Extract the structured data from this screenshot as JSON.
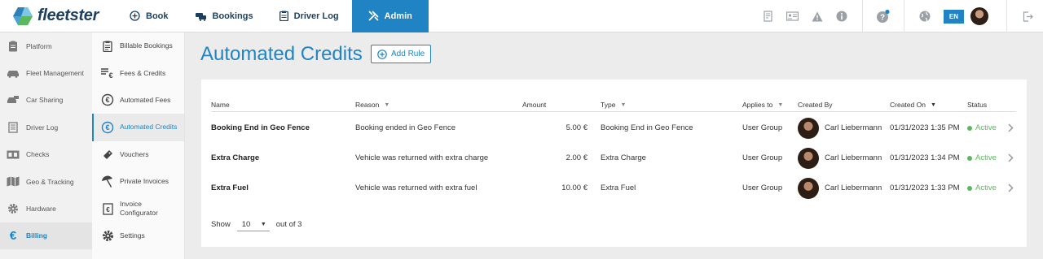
{
  "brand": {
    "name": "fleetster"
  },
  "topnav": [
    {
      "label": "Book",
      "icon": "plus-circle-icon"
    },
    {
      "label": "Bookings",
      "icon": "cars-icon"
    },
    {
      "label": "Driver Log",
      "icon": "clipboard-icon"
    },
    {
      "label": "Admin",
      "icon": "tools-icon",
      "active": true
    }
  ],
  "topright": {
    "language": "EN"
  },
  "sidebar_main": [
    {
      "label": "Platform"
    },
    {
      "label": "Fleet Management"
    },
    {
      "label": "Car Sharing"
    },
    {
      "label": "Driver Log"
    },
    {
      "label": "Checks"
    },
    {
      "label": "Geo & Tracking"
    },
    {
      "label": "Hardware"
    },
    {
      "label": "Billing",
      "active": true,
      "icon_glyph": "€"
    }
  ],
  "sidebar_sub": [
    {
      "label": "Billable Bookings"
    },
    {
      "label": "Fees & Credits"
    },
    {
      "label": "Automated Fees"
    },
    {
      "label": "Automated Credits",
      "active": true
    },
    {
      "label": "Vouchers"
    },
    {
      "label": "Private Invoices"
    },
    {
      "label": "Invoice Configurator"
    },
    {
      "label": "Settings"
    }
  ],
  "page": {
    "title": "Automated Credits",
    "add_rule_label": "Add Rule"
  },
  "table": {
    "columns": [
      "Name",
      "Reason",
      "Amount",
      "Type",
      "Applies to",
      "Created By",
      "Created On",
      "Status"
    ],
    "rows": [
      {
        "name": "Booking End in Geo Fence",
        "reason": "Booking ended in Geo Fence",
        "amount": "5.00 €",
        "type": "Booking End in Geo Fence",
        "applies_to": "User Group",
        "created_by": "Carl Liebermann",
        "created_on": "01/31/2023 1:35 PM",
        "status": "Active"
      },
      {
        "name": "Extra Charge",
        "reason": "Vehicle was returned with extra charge",
        "amount": "2.00 €",
        "type": "Extra Charge",
        "applies_to": "User Group",
        "created_by": "Carl Liebermann",
        "created_on": "01/31/2023 1:34 PM",
        "status": "Active"
      },
      {
        "name": "Extra Fuel",
        "reason": "Vehicle was returned with extra fuel",
        "amount": "10.00 €",
        "type": "Extra Fuel",
        "applies_to": "User Group",
        "created_by": "Carl Liebermann",
        "created_on": "01/31/2023 1:33 PM",
        "status": "Active"
      }
    ]
  },
  "pager": {
    "show_label": "Show",
    "page_size": "10",
    "total_label": "out of 3"
  },
  "colors": {
    "accent": "#1f83c4",
    "brand_dark": "#1d3f5e",
    "active_status": "#5cb85c"
  }
}
